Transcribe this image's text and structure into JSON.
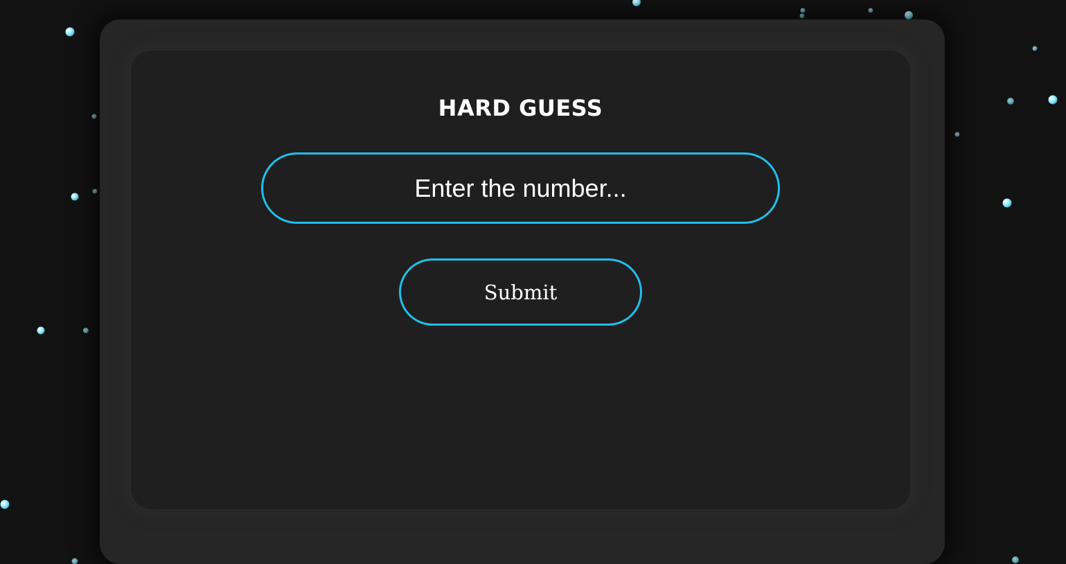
{
  "game": {
    "title": "HARD GUESS",
    "input_placeholder": "Enter the number...",
    "input_value": "",
    "submit_label": "Submit"
  },
  "theme": {
    "background": "#121212",
    "frame": "#262626",
    "card": "#1f1f1f",
    "accent": "#1fc0ec",
    "particle": "#63d8f0"
  }
}
